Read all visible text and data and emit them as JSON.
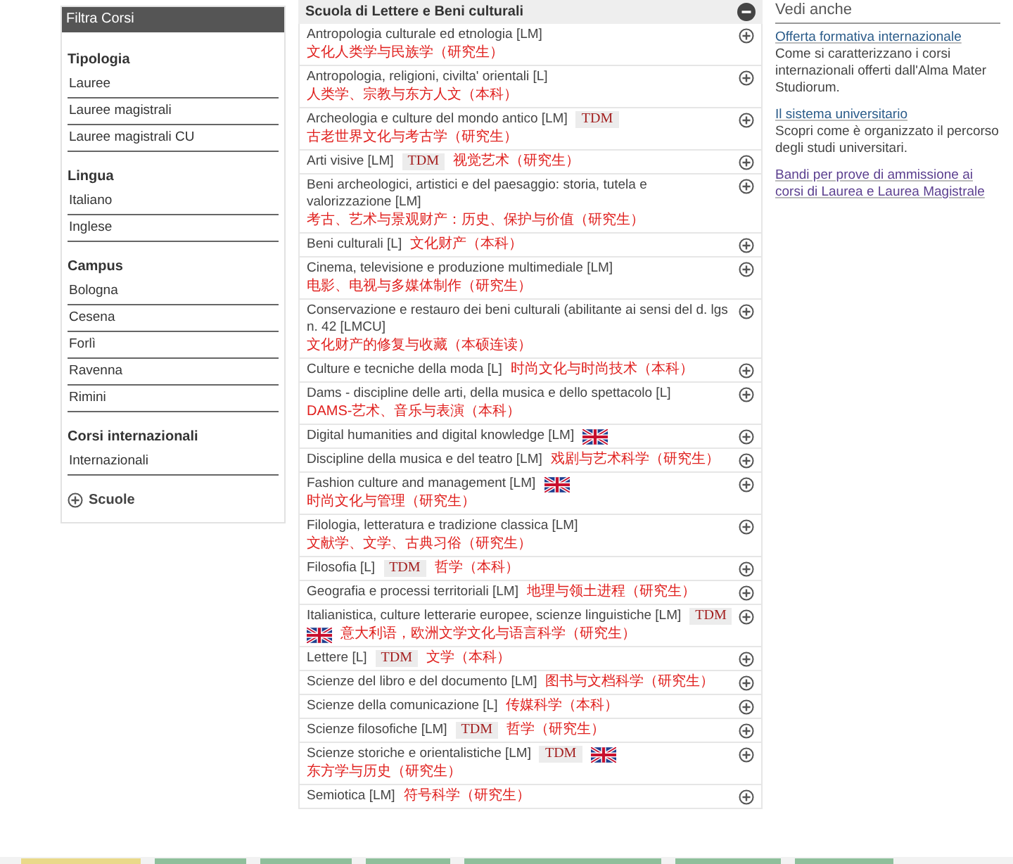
{
  "filter": {
    "title": "Filtra Corsi",
    "groups": [
      {
        "heading": "Tipologia",
        "items": [
          "Lauree",
          "Lauree magistrali",
          "Lauree magistrali CU"
        ]
      },
      {
        "heading": "Lingua",
        "items": [
          "Italiano",
          "Inglese"
        ]
      },
      {
        "heading": "Campus",
        "items": [
          "Bologna",
          "Cesena",
          "Forlì",
          "Ravenna",
          "Rimini"
        ]
      },
      {
        "heading": "Corsi internazionali",
        "items": [
          "Internazionali"
        ]
      }
    ],
    "toggle": {
      "label": "Scuole",
      "expanded": false
    }
  },
  "school": {
    "title": "Scuola di Lettere e Beni culturali",
    "expanded": true,
    "courses": [
      {
        "title": "Antropologia culturale ed etnologia [LM]",
        "note": "文化人类学与民族学（研究生）",
        "expanded": false
      },
      {
        "title": "Antropologia, religioni, civilta' orientali [L]",
        "note": "人类学、宗教与东方人文（本科）",
        "expanded": false
      },
      {
        "title": "Archeologia e culture del mondo antico [LM]",
        "badges": [
          {
            "kind": "tdm",
            "text": "TDM"
          }
        ],
        "note": "古老世界文化与考古学（研究生）",
        "expanded": false
      },
      {
        "title": "Arti visive [LM]",
        "badges": [
          {
            "kind": "tdm",
            "text": "TDM"
          }
        ],
        "note": "视觉艺术（研究生）",
        "expanded": false
      },
      {
        "title": "Beni archeologici, artistici e del paesaggio: storia, tutela e valorizzazione [LM]",
        "note": "考古、艺术与景观财产：历史、保护与价值（研究生）",
        "expanded": false
      },
      {
        "title": "Beni culturali [L]",
        "note": "文化财产（本科）",
        "expanded": false
      },
      {
        "title": "Cinema, televisione e produzione multimediale [LM]",
        "note": "电影、电视与多媒体制作（研究生）",
        "expanded": false
      },
      {
        "title": "Conservazione e restauro dei beni culturali (abilitante ai sensi del d. lgs n. 42 [LMCU]",
        "note": "文化财产的修复与收藏（本硕连读）",
        "expanded": false
      },
      {
        "title": "Culture e tecniche della moda [L]",
        "note": "时尚文化与时尚技术（本科）",
        "expanded": false
      },
      {
        "title": "Dams - discipline delle arti, della musica e dello spettacolo [L]",
        "note": "DAMS-艺术、音乐与表演（本科）",
        "expanded": false
      },
      {
        "title": "Digital humanities and digital knowledge [LM]",
        "badges": [
          {
            "kind": "flag"
          }
        ],
        "expanded": false
      },
      {
        "title": "Discipline della musica e del teatro [LM]",
        "note": "戏剧与艺术科学（研究生）",
        "expanded": false
      },
      {
        "title": "Fashion culture and management [LM]",
        "badges": [
          {
            "kind": "flag"
          }
        ],
        "note": "时尚文化与管理（研究生）",
        "expanded": false
      },
      {
        "title": "Filologia, letteratura e tradizione classica [LM]",
        "note": "文献学、文学、古典习俗（研究生）",
        "expanded": false
      },
      {
        "title": "Filosofia [L]",
        "badges": [
          {
            "kind": "tdm",
            "text": "TDM"
          }
        ],
        "note": "哲学（本科）",
        "expanded": false
      },
      {
        "title": "Geografia e processi territoriali [LM]",
        "note": "地理与领土进程（研究生）",
        "expanded": false
      },
      {
        "title": "Italianistica, culture letterarie europee, scienze linguistiche [LM]",
        "badges": [
          {
            "kind": "tdm",
            "text": "TDM"
          },
          {
            "kind": "flag"
          }
        ],
        "note": "意大利语，欧洲文学文化与语言科学（研究生）",
        "expanded": false
      },
      {
        "title": "Lettere [L]",
        "badges": [
          {
            "kind": "tdm",
            "text": "TDM"
          }
        ],
        "note": "文学（本科）",
        "expanded": false
      },
      {
        "title": "Scienze del libro e del documento [LM]",
        "note": "图书与文档科学（研究生）",
        "expanded": false
      },
      {
        "title": "Scienze della comunicazione [L]",
        "note": "传媒科学（本科）",
        "expanded": false
      },
      {
        "title": "Scienze filosofiche [LM]",
        "badges": [
          {
            "kind": "tdm",
            "text": "TDM"
          }
        ],
        "note": "哲学（研究生）",
        "expanded": false
      },
      {
        "title": "Scienze storiche e orientalistiche [LM]",
        "badges": [
          {
            "kind": "tdm",
            "text": "TDM"
          },
          {
            "kind": "flag"
          }
        ],
        "note": "东方学与历史（研究生）",
        "expanded": false
      },
      {
        "title": "Semiotica [LM]",
        "note": "符号科学（研究生）",
        "expanded": false
      }
    ]
  },
  "see_also": {
    "title": "Vedi anche",
    "links": [
      {
        "label": "Offerta formativa internazionale",
        "visited": false,
        "text": "Come si caratterizzano i corsi internazionali offerti dall'Alma Mater Studiorum."
      },
      {
        "label": "Il sistema universitario",
        "visited": false,
        "text": "Scopri come è organizzato il percorso degli studi universitari."
      },
      {
        "label": "Bandi per prove di ammissione ai corsi di Laurea e Laurea Magistrale",
        "visited": true
      }
    ]
  }
}
